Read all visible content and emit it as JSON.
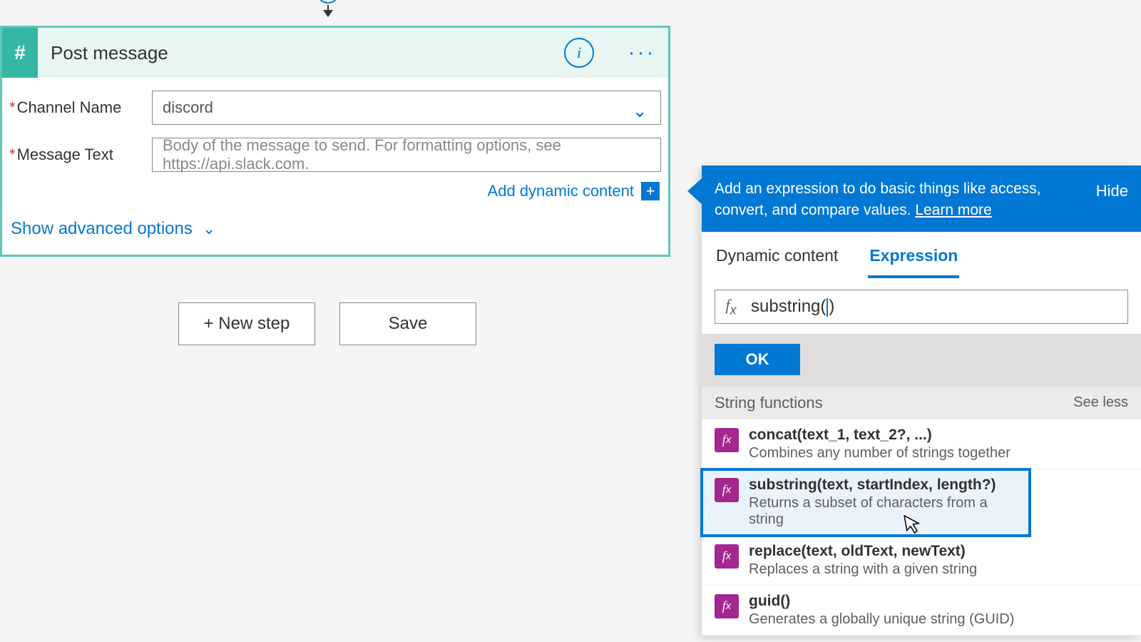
{
  "flow_plus": "+",
  "action": {
    "title": "Post message",
    "icon_glyph": "#",
    "channel_label": "Channel Name",
    "channel_value": "discord",
    "message_label": "Message Text",
    "message_placeholder": "Body of the message to send. For formatting options, see https://api.slack.com.",
    "add_dynamic": "Add dynamic content",
    "advanced": "Show advanced options"
  },
  "buttons": {
    "new_step": "+ New step",
    "save": "Save"
  },
  "expr": {
    "banner_pre": "Add an expression to do basic things like access, convert, and compare values. ",
    "banner_link": "Learn more",
    "hide": "Hide",
    "tab_dynamic": "Dynamic content",
    "tab_expression": "Expression",
    "input_before": "substring(",
    "input_after": ")",
    "ok": "OK",
    "section_title": "String functions",
    "see_less": "See less",
    "functions": [
      {
        "sig": "concat(text_1, text_2?, ...)",
        "desc": "Combines any number of strings together"
      },
      {
        "sig": "substring(text, startIndex, length?)",
        "desc": "Returns a subset of characters from a string"
      },
      {
        "sig": "replace(text, oldText, newText)",
        "desc": "Replaces a string with a given string"
      },
      {
        "sig": "guid()",
        "desc": "Generates a globally unique string (GUID)"
      }
    ]
  }
}
